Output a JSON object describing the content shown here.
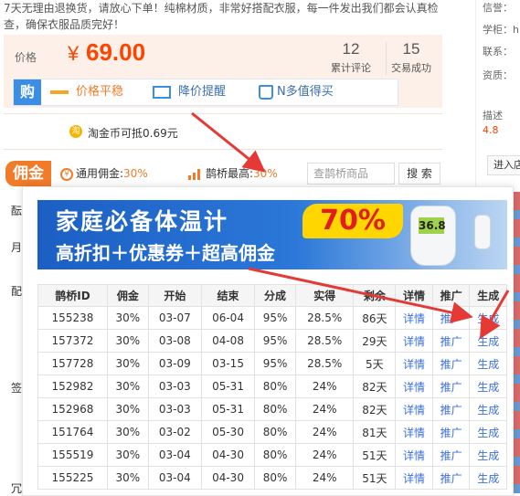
{
  "top_note": "7天无理由退换货，请放心下单！纯棉材质，非常好搭配衣服，每一件发出我们都会认真检查，确保衣服品质完好！",
  "price": {
    "label": "价格",
    "currency": "¥",
    "value": "69.00",
    "reviews_count": "12",
    "reviews_label": "累计评论",
    "trades_count": "15",
    "trades_label": "交易成功"
  },
  "toolbar": {
    "gou_label": "购",
    "price_flat": "价格平稳",
    "price_alert": "降价提醒",
    "worth_buy": "N多值得买"
  },
  "taojin": {
    "coin_glyph": "淘",
    "text": "淘金币可抵0.69元"
  },
  "commission": {
    "badge": "佣金",
    "general_label": "通用佣金:",
    "general_value": "30%",
    "max_label": "鹊桥最高:",
    "max_value": "30%",
    "search_placeholder": "查鹊桥商品",
    "search_button": "搜 索"
  },
  "side_fragments": [
    "酝",
    "月",
    "配",
    "签",
    "冗"
  ],
  "right_column": {
    "credit": "信誉：",
    "school": "学柜：h",
    "contact": "联系：",
    "qualification": "资质：",
    "describe": "描述",
    "rating": "4.8",
    "enter_shop": "进入店"
  },
  "banner": {
    "title": "家庭必备体温计",
    "percent": "70%",
    "subtitle": "高折扣＋优惠券＋超高佣金",
    "device_reading": "36.8"
  },
  "table": {
    "headers": [
      "鹊桥ID",
      "佣金",
      "开始",
      "结束",
      "分成",
      "实得",
      "剩余",
      "详情",
      "推广",
      "生成"
    ],
    "rows": [
      [
        "155238",
        "30%",
        "03-07",
        "06-04",
        "95%",
        "28.5%",
        "86天",
        "详情",
        "推广",
        "生成"
      ],
      [
        "157372",
        "30%",
        "03-08",
        "04-08",
        "95%",
        "28.5%",
        "29天",
        "详情",
        "推广",
        "生成"
      ],
      [
        "157728",
        "30%",
        "03-09",
        "03-15",
        "95%",
        "28.5%",
        "5天",
        "详情",
        "推广",
        "生成"
      ],
      [
        "152982",
        "30%",
        "03-03",
        "05-31",
        "80%",
        "24%",
        "82天",
        "详情",
        "推广",
        "生成"
      ],
      [
        "152968",
        "30%",
        "03-03",
        "05-31",
        "80%",
        "24%",
        "82天",
        "详情",
        "推广",
        "生成"
      ],
      [
        "151764",
        "30%",
        "03-02",
        "05-30",
        "80%",
        "24%",
        "81天",
        "详情",
        "推广",
        "生成"
      ],
      [
        "155519",
        "30%",
        "03-04",
        "04-30",
        "80%",
        "24%",
        "51天",
        "详情",
        "推广",
        "生成"
      ],
      [
        "155225",
        "30%",
        "03-04",
        "04-30",
        "80%",
        "24%",
        "51天",
        "详情",
        "推广",
        "生成"
      ]
    ]
  },
  "colors": {
    "price": "#ff4400",
    "accent_orange": "#f27b2a",
    "link_blue": "#3a6fdf",
    "arrow_red": "#e53935"
  }
}
